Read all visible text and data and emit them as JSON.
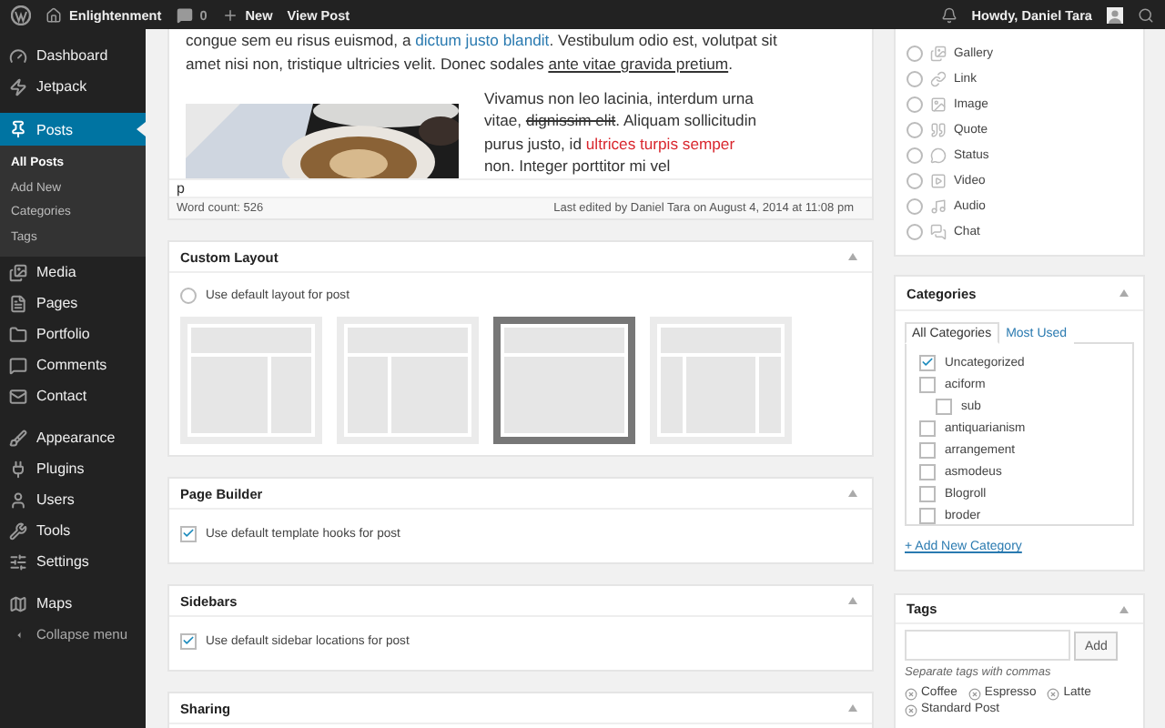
{
  "admin_bar": {
    "site": "Enlightenment",
    "comments": "0",
    "new": "New",
    "view": "View Post",
    "greeting": "Howdy, Daniel Tara"
  },
  "sidebar": {
    "groups": [
      [
        {
          "label": "Dashboard",
          "selected": false
        },
        {
          "label": "Jetpack",
          "selected": false
        }
      ],
      [
        {
          "label": "Posts",
          "selected": true,
          "children": [
            {
              "label": "All Posts",
              "selected": true
            },
            {
              "label": "Add New",
              "selected": false
            },
            {
              "label": "Categories",
              "selected": false
            },
            {
              "label": "Tags",
              "selected": false
            }
          ]
        },
        {
          "label": "Media",
          "selected": false
        },
        {
          "label": "Pages",
          "selected": false
        },
        {
          "label": "Portfolio",
          "selected": false
        },
        {
          "label": "Comments",
          "selected": false
        },
        {
          "label": "Contact",
          "selected": false
        }
      ],
      [
        {
          "label": "Appearance",
          "selected": false
        },
        {
          "label": "Plugins",
          "selected": false
        },
        {
          "label": "Users",
          "selected": false
        },
        {
          "label": "Tools",
          "selected": false
        },
        {
          "label": "Settings",
          "selected": false
        }
      ],
      [
        {
          "label": "Maps",
          "selected": false
        }
      ]
    ],
    "collapse": "Collapse menu"
  },
  "editor": {
    "paragraph_1": [
      {
        "kind": "plain",
        "text": "congue sem eu risus euismod, a "
      },
      {
        "kind": "link",
        "text": "dictum justo blandit"
      },
      {
        "kind": "plain",
        "text": ". Vestibulum odio est, volutpat sit amet nisi non, tristique ultricies velit. Donec sodales "
      },
      {
        "kind": "underline",
        "text": "ante vitae gravida pretium"
      },
      {
        "kind": "plain",
        "text": "."
      }
    ],
    "paragraph_2": [
      {
        "kind": "plain",
        "text": "Vivamus non leo lacinia, interdum urna vitae, "
      },
      {
        "kind": "strike",
        "text": "dignissim elit"
      },
      {
        "kind": "plain",
        "text": ". Aliquam sollicitudin purus justo, id "
      },
      {
        "kind": "red",
        "text": "ultrices turpis semper"
      },
      {
        "kind": "plain",
        "text": " non. Integer porttitor mi vel"
      }
    ],
    "path": "p",
    "word_count": "Word count: 526",
    "last_edited": "Last edited by Daniel Tara on August 4, 2014 at 11:08 pm"
  },
  "custom_layout": {
    "title": "Custom Layout",
    "default_option": {
      "label": "Use default layout for post",
      "checked": false
    },
    "layouts": [
      {
        "kind": "content-sidebar",
        "selected": false
      },
      {
        "kind": "sidebar-content",
        "selected": false
      },
      {
        "kind": "full-width",
        "selected": true
      },
      {
        "kind": "sidebar-content-sidebar",
        "selected": false
      }
    ]
  },
  "page_builder": {
    "title": "Page Builder",
    "option": {
      "label": "Use default template hooks for post",
      "checked": true
    }
  },
  "sidebars": {
    "title": "Sidebars",
    "option": {
      "label": "Use default sidebar locations for post",
      "checked": true
    }
  },
  "sharing": {
    "title": "Sharing"
  },
  "post_format": {
    "formats": [
      {
        "label": "Gallery",
        "selected": false
      },
      {
        "label": "Link",
        "selected": false
      },
      {
        "label": "Image",
        "selected": false
      },
      {
        "label": "Quote",
        "selected": false
      },
      {
        "label": "Status",
        "selected": false
      },
      {
        "label": "Video",
        "selected": false
      },
      {
        "label": "Audio",
        "selected": false
      },
      {
        "label": "Chat",
        "selected": false
      }
    ]
  },
  "categories": {
    "title": "Categories",
    "tabs": [
      {
        "label": "All Categories",
        "selected": true
      },
      {
        "label": "Most Used",
        "selected": false
      }
    ],
    "items": [
      {
        "label": "Uncategorized",
        "checked": true
      },
      {
        "label": "aciform",
        "checked": false,
        "children": [
          {
            "label": "sub",
            "checked": false
          }
        ]
      },
      {
        "label": "antiquarianism",
        "checked": false
      },
      {
        "label": "arrangement",
        "checked": false
      },
      {
        "label": "asmodeus",
        "checked": false
      },
      {
        "label": "Blogroll",
        "checked": false
      },
      {
        "label": "broder",
        "checked": false
      }
    ],
    "add_link": "+ Add New Category"
  },
  "tags": {
    "title": "Tags",
    "button": "Add",
    "hint": "Separate tags with commas",
    "items": [
      "Coffee",
      "Espresso",
      "Latte",
      "Standard Post"
    ]
  }
}
